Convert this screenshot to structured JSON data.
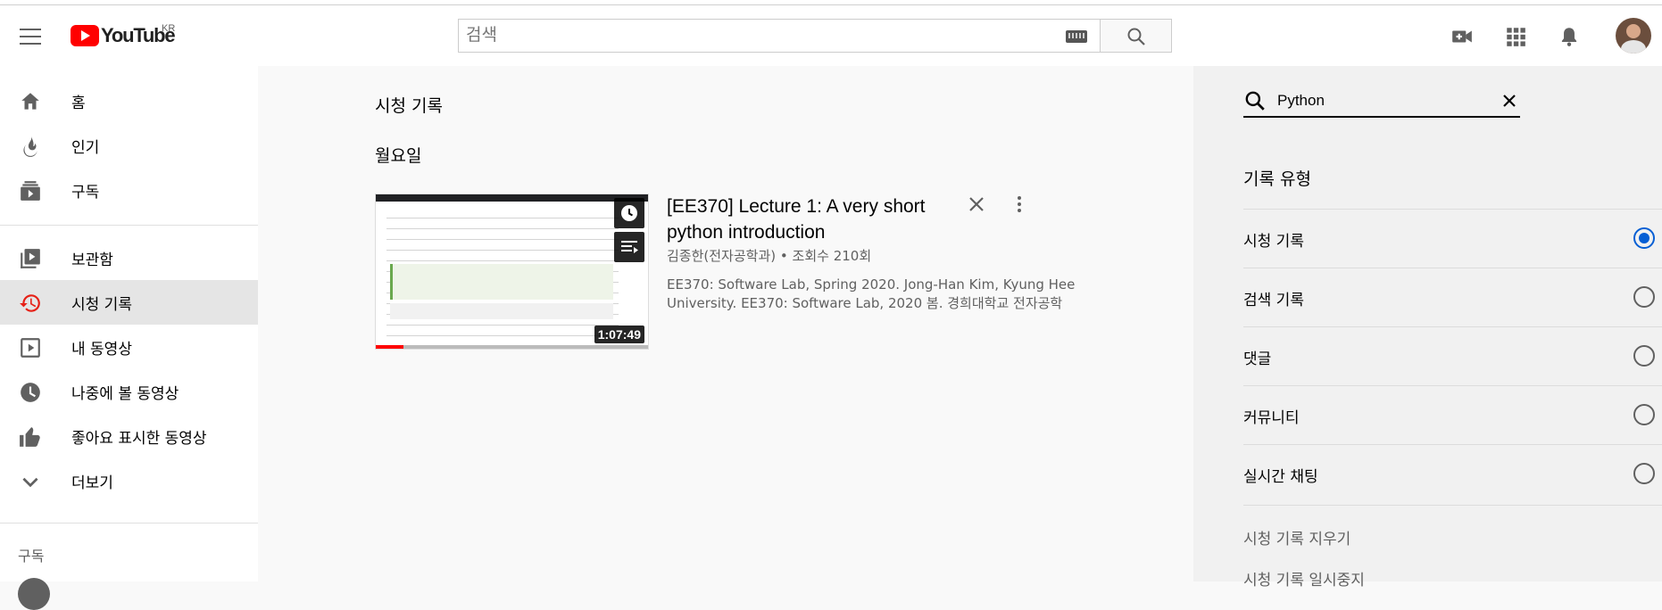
{
  "header": {
    "logo_text": "YouTube",
    "country": "KR",
    "search_placeholder": "검색"
  },
  "sidebar": {
    "items": [
      {
        "label": "홈",
        "icon": "home-icon"
      },
      {
        "label": "인기",
        "icon": "fire-icon"
      },
      {
        "label": "구독",
        "icon": "subscriptions-icon"
      },
      {
        "label": "보관함",
        "icon": "library-icon"
      },
      {
        "label": "시청 기록",
        "icon": "history-icon",
        "active": true
      },
      {
        "label": "내 동영상",
        "icon": "play-square-icon"
      },
      {
        "label": "나중에 볼 동영상",
        "icon": "clock-icon"
      },
      {
        "label": "좋아요 표시한 동영상",
        "icon": "thumb-up-icon"
      },
      {
        "label": "더보기",
        "icon": "chevron-down-icon"
      }
    ],
    "section_title": "구독"
  },
  "main": {
    "title": "시청 기록",
    "day": "월요일",
    "video": {
      "title": "[EE370] Lecture 1: A very short python introduction",
      "channel": "김종한(전자공학과)",
      "separator": "•",
      "views": "조회수 210회",
      "description": "EE370: Software Lab, Spring 2020. Jong-Han Kim, Kyung Hee University. EE370: Software Lab, 2020 봄. 경희대학교 전자공학",
      "duration": "1:07:49",
      "progress": 0.1
    }
  },
  "right": {
    "search_value": "Python",
    "type_title": "기록 유형",
    "options": [
      {
        "label": "시청 기록",
        "selected": true
      },
      {
        "label": "검색 기록",
        "selected": false
      },
      {
        "label": "댓글",
        "selected": false
      },
      {
        "label": "커뮤니티",
        "selected": false
      },
      {
        "label": "실시간 채팅",
        "selected": false
      }
    ],
    "links": [
      "시청 기록 지우기",
      "시청 기록 일시중지"
    ]
  },
  "colors": {
    "brand": "#ff0000",
    "accent": "#065fd4"
  }
}
